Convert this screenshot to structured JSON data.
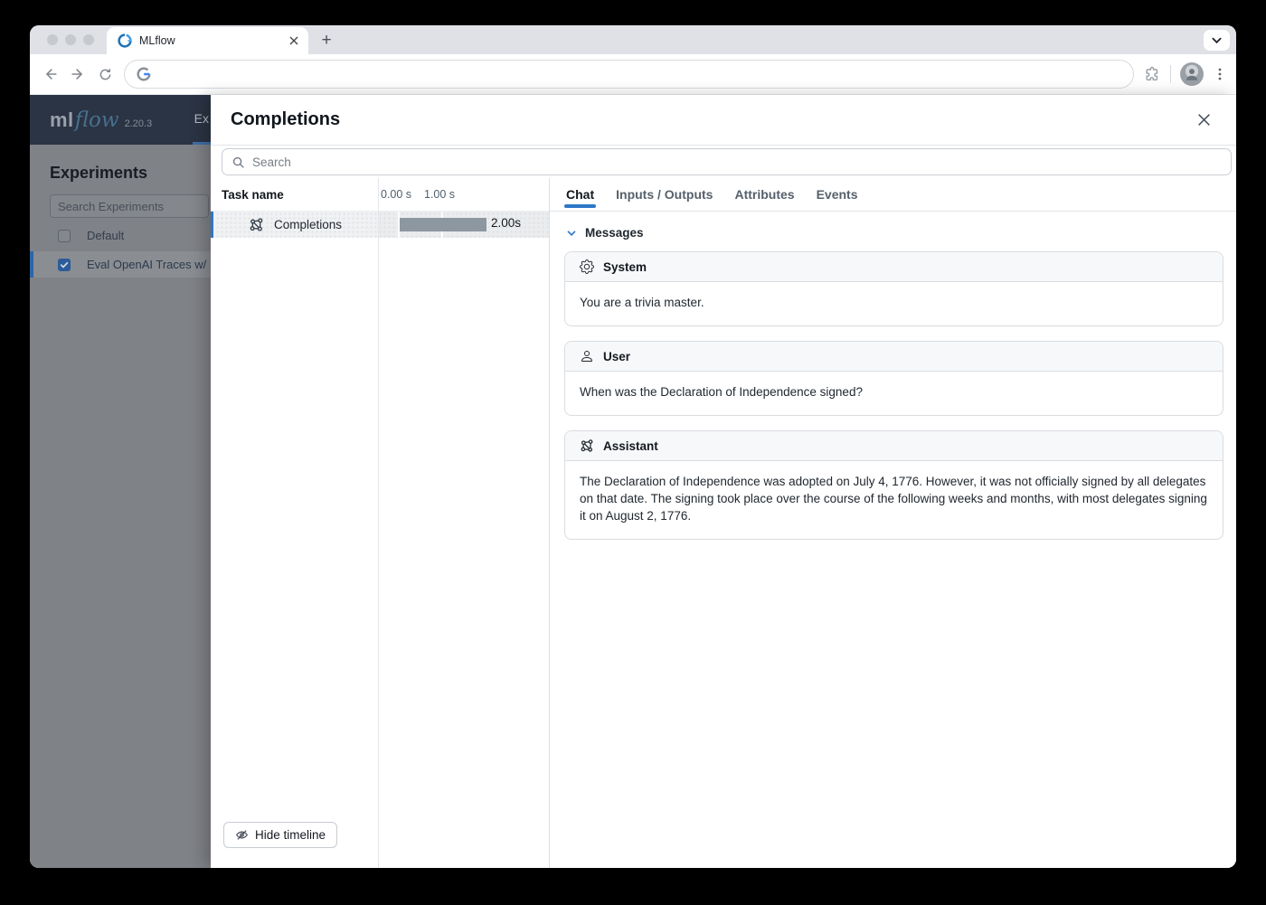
{
  "colors": {
    "accent_blue": "#2d77c7",
    "timeline_bar": "#8d97a0",
    "app_header_bg": "#2b3444",
    "dim_sidebar_bg": "#7f8287",
    "card_header_bg": "#f7f8fa"
  },
  "browser": {
    "tab_title": "MLflow",
    "new_tab_label": "+"
  },
  "app": {
    "logo_ml": "ml",
    "logo_flow": "flow",
    "version": "2.20.3",
    "nav_truncated": "Ex",
    "sidebar": {
      "heading": "Experiments",
      "search_placeholder": "Search Experiments",
      "items": [
        {
          "label": "Default",
          "checked": false
        },
        {
          "label": "Eval OpenAI Traces w/",
          "checked": true
        }
      ]
    }
  },
  "drawer": {
    "title": "Completions",
    "search_placeholder": "Search",
    "timeline": {
      "task_name_header": "Task name",
      "tick_labels": [
        "0.00 s",
        "1.00 s"
      ],
      "rows": [
        {
          "name": "Completions",
          "icon": "model-icon",
          "start_s": 0.0,
          "duration_s": 2.0,
          "duration_label": "2.00s",
          "selected": true
        }
      ],
      "hide_button_label": "Hide timeline"
    },
    "tabs": [
      {
        "label": "Chat",
        "active": true
      },
      {
        "label": "Inputs / Outputs",
        "active": false
      },
      {
        "label": "Attributes",
        "active": false
      },
      {
        "label": "Events",
        "active": false
      }
    ],
    "chat": {
      "section_label": "Messages",
      "messages": [
        {
          "role": "System",
          "icon": "gear-icon",
          "text": "You are a trivia master."
        },
        {
          "role": "User",
          "icon": "person-icon",
          "text": "When was the Declaration of Independence signed?"
        },
        {
          "role": "Assistant",
          "icon": "model-icon",
          "text": "The Declaration of Independence was adopted on July 4, 1776. However, it was not officially signed by all delegates on that date. The signing took place over the course of the following weeks and months, with most delegates signing it on August 2, 1776."
        }
      ]
    }
  }
}
